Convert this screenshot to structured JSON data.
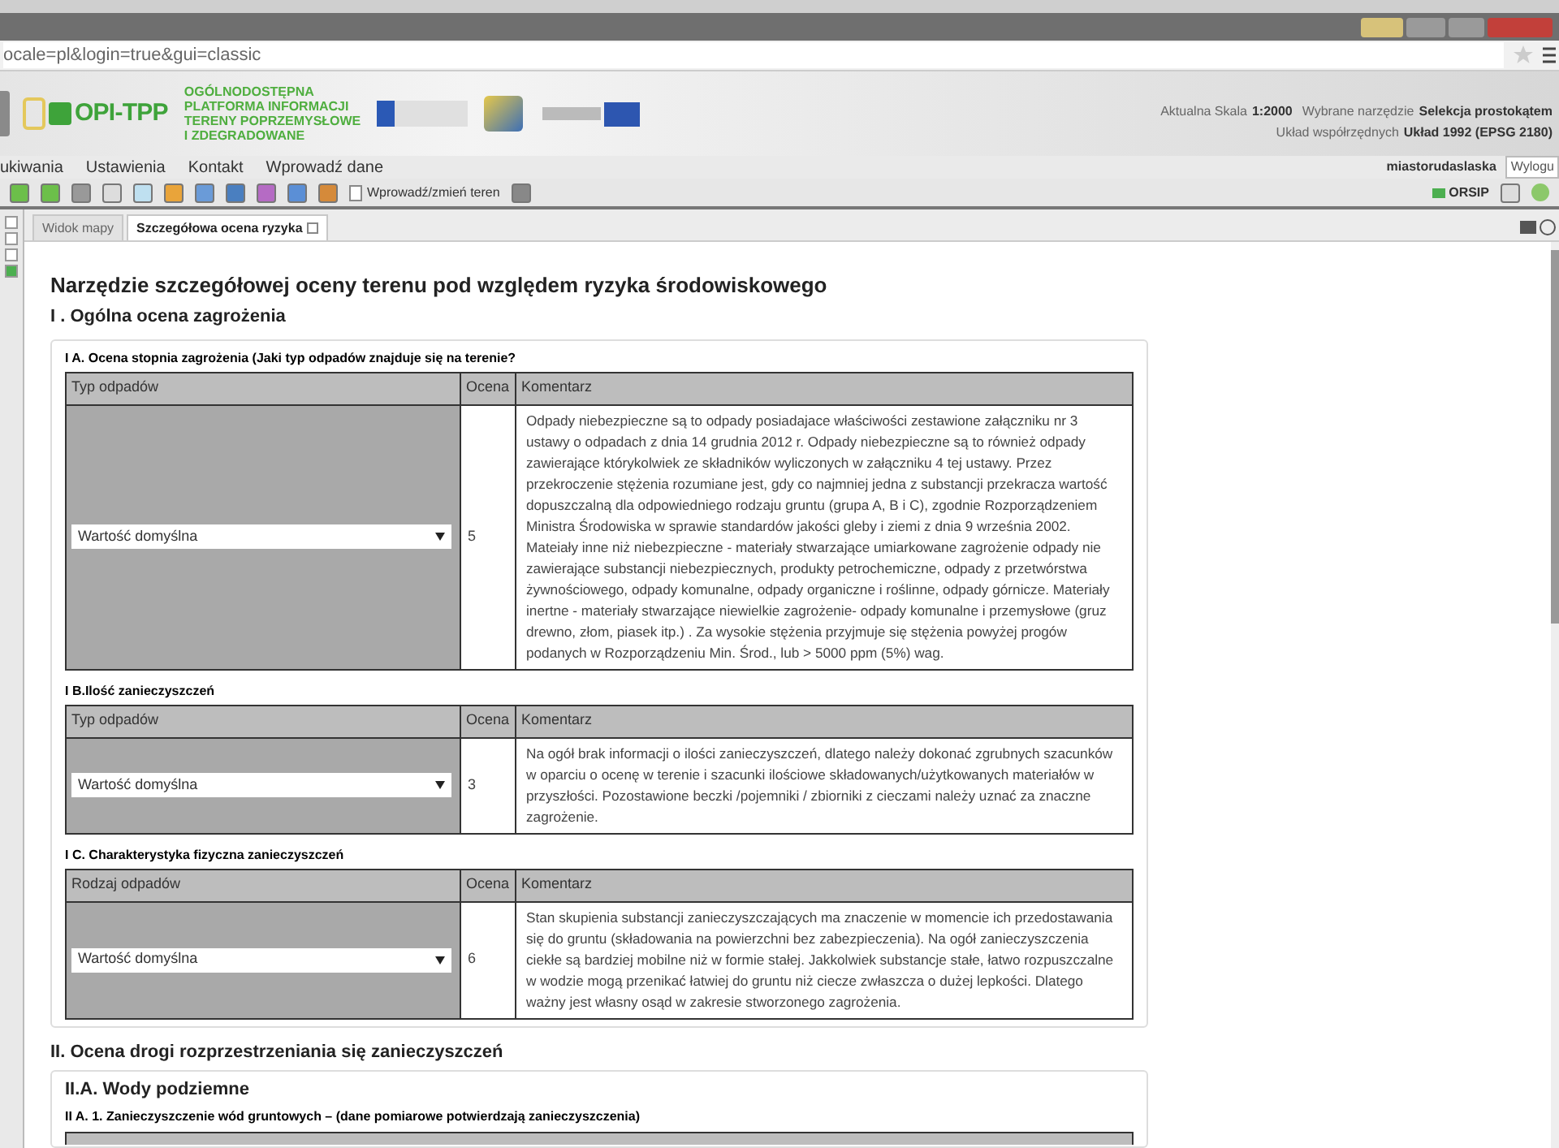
{
  "browser": {
    "address": "ocale=pl&login=true&gui=classic"
  },
  "header": {
    "logo": "OPI-TPP",
    "platform_lines": [
      "OGÓLNODOSTĘPNA",
      "PLATFORMA INFORMACJI",
      "TERENY POPRZEMYSŁOWE",
      "I ZDEGRADOWANE"
    ],
    "scale_label": "Aktualna Skala",
    "scale": "1:2000",
    "tool_label": "Wybrane narzędzie",
    "tool": "Selekcja prostokątem",
    "crs_label": "Układ współrzędnych",
    "crs": "Układ 1992 (EPSG 2180)",
    "user": "miastorudaslaska",
    "logout": "Wylogu"
  },
  "menu": [
    "ukiwania",
    "Ustawienia",
    "Kontakt",
    "Wprowadź dane"
  ],
  "toolbar": {
    "edit_button": "Wprowadź/zmień teren",
    "orsip": "ORSIP"
  },
  "tabs": [
    {
      "label": "Widok mapy",
      "selected": false
    },
    {
      "label": "Szczegółowa ocena ryzyka",
      "selected": true
    }
  ],
  "page_title": "Narzędzie szczegółowej oceny terenu pod względem ryzyka środowiskowego",
  "section_1": {
    "heading": "I . Ogólna ocena zagrożenia",
    "subsections": [
      {
        "caption": "I A. Ocena stopnia zagrożenia (Jaki typ odpadów znajduje się na terenie?",
        "columns": [
          "Typ odpadów",
          "Ocena",
          "Komentarz"
        ],
        "select": "Wartość domyślna",
        "score": "5",
        "comment": "Odpady niebezpieczne są to odpady posiadajace właściwości zestawione załączniku nr 3 ustawy o odpadach z dnia 14 grudnia 2012 r. Odpady niebezpieczne są to również odpady zawierające którykolwiek ze składników wyliczonych w załączniku 4 tej ustawy. Przez przekroczenie stężenia rozumiane jest, gdy co najmniej jedna z substancji przekracza wartość dopuszczalną dla odpowiedniego rodzaju gruntu (grupa A, B i C), zgodnie Rozporządzeniem Ministra Środowiska w sprawie standardów jakości gleby i ziemi z dnia 9 września 2002. Mateiały inne niż niebezpieczne - materiały stwarzające umiarkowane zagrożenie  odpady nie zawierające substancji niebezpiecznych, produkty petrochemiczne, odpady z przetwórstwa żywnościowego, odpady komunalne, odpady organiczne i roślinne, odpady górnicze. Materiały inertne - materiały stwarzające niewielkie zagrożenie- odpady komunalne i przemysłowe (gruz drewno, złom, piasek itp.) . Za wysokie stężenia przyjmuje się stężenia powyżej progów podanych w Rozporządzeniu Min. Środ., lub > 5000 ppm (5%) wag."
      },
      {
        "caption": "I B.Ilość zanieczyszczeń",
        "columns": [
          "Typ odpadów",
          "Ocena",
          "Komentarz"
        ],
        "select": "Wartość domyślna",
        "score": "3",
        "comment": "Na ogół brak informacji o ilości zanieczyszczeń, dlatego należy dokonać zgrubnych szacunków w oparciu o ocenę w terenie i szacunki ilościowe składowanych/użytkowanych materiałów w przyszłości. Pozostawione beczki /pojemniki / zbiorniki z cieczami należy uznać za znaczne zagrożenie."
      },
      {
        "caption": "I C. Charakterystyka fizyczna zanieczyszczeń",
        "columns": [
          "Rodzaj odpadów",
          "Ocena",
          "Komentarz"
        ],
        "select": "Wartość domyślna",
        "score": "6",
        "comment": "Stan skupienia substancji zanieczyszczających ma znaczenie w momencie ich przedostawania się do gruntu (składowania na powierzchni bez zabezpieczenia). Na ogół zanieczyszczenia ciekłe są bardziej mobilne niż w formie stałej. Jakkolwiek substancje stałe, łatwo rozpuszczalne w wodzie mogą przenikać łatwiej do gruntu niż ciecze zwłaszcza o dużej lepkości. Dlatego ważny jest własny osąd w zakresie stworzonego zagrożenia."
      }
    ]
  },
  "section_2": {
    "heading": "II. Ocena drogi rozprzestrzeniania się zanieczyszczeń",
    "subsection": {
      "heading": "II.A. Wody podziemne",
      "caption": "II A. 1. Zanieczyszczenie wód gruntowych – (dane pomiarowe potwierdzają zanieczyszczenia)"
    }
  }
}
